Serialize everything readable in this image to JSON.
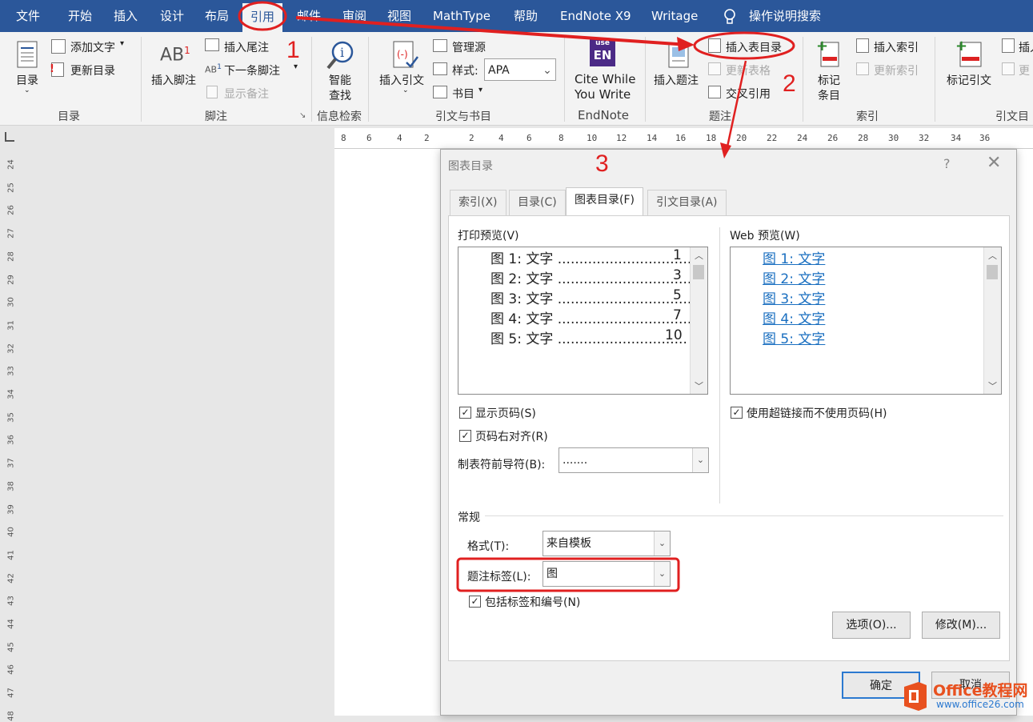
{
  "tabs": [
    "文件",
    "开始",
    "插入",
    "设计",
    "布局",
    "引用",
    "邮件",
    "审阅",
    "视图",
    "MathType",
    "帮助",
    "EndNote X9",
    "Writage"
  ],
  "tell_me": "操作说明搜索",
  "ribbon": {
    "toc": {
      "label": "目录",
      "add_text": "添加文字",
      "update": "更新目录",
      "group": "目录"
    },
    "footnotes": {
      "insert": "插入脚注",
      "insert_endnote": "插入尾注",
      "next": "下一条脚注",
      "show": "显示备注",
      "group": "脚注"
    },
    "research": {
      "smart_lookup": "智能",
      "smart_lookup2": "查找",
      "group": "信息检索"
    },
    "citations": {
      "insert": "插入引文",
      "manage": "管理源",
      "style_label": "样式:",
      "style_value": "APA",
      "bibliography": "书目",
      "group": "引文与书目"
    },
    "endnote": {
      "cwyw1": "Cite While",
      "cwyw2": "You Write",
      "group": "EndNote",
      "logo": "EN",
      "logo_top": "use"
    },
    "captions": {
      "insert_caption": "插入题注",
      "insert_tof": "插入表目录",
      "update_table": "更新表格",
      "cross_ref": "交叉引用",
      "group": "题注"
    },
    "index": {
      "mark1": "标记",
      "mark2": "条目",
      "insert": "插入索引",
      "update": "更新索引",
      "group": "索引"
    },
    "toa": {
      "mark": "标记引文",
      "insert": "插入",
      "group": "引文目",
      "update": "更"
    }
  },
  "ruler_h": [
    "8",
    "6",
    "4",
    "2",
    "2",
    "4",
    "6",
    "8",
    "10",
    "12",
    "14",
    "16",
    "18",
    "20",
    "22",
    "24",
    "26",
    "28",
    "30",
    "32",
    "34",
    "36"
  ],
  "ruler_v": [
    "24",
    "25",
    "26",
    "27",
    "28",
    "29",
    "30",
    "31",
    "32",
    "33",
    "34",
    "35",
    "36",
    "37",
    "38",
    "39",
    "40",
    "41",
    "42",
    "43",
    "44",
    "45",
    "46",
    "47",
    "48"
  ],
  "dialog": {
    "title": "图表目录",
    "help": "?",
    "tabs": [
      "索引(X)",
      "目录(C)",
      "图表目录(F)",
      "引文目录(A)"
    ],
    "print_preview_label": "打印预览(V)",
    "print_rows": [
      {
        "text": "图 1: 文字 ..................................",
        "page": "1"
      },
      {
        "text": "图 2: 文字 ..................................",
        "page": "3"
      },
      {
        "text": "图 3: 文字 ..................................",
        "page": "5"
      },
      {
        "text": "图 4: 文字 ..................................",
        "page": "7"
      },
      {
        "text": "图 5: 文字 ..............................",
        "page": "10"
      }
    ],
    "web_preview_label": "Web 预览(W)",
    "web_rows": [
      "图 1: 文字",
      "图 2: 文字",
      "图 3: 文字",
      "图 4: 文字",
      "图 5: 文字"
    ],
    "show_page_numbers": "显示页码(S)",
    "right_align": "页码右对齐(R)",
    "tab_leader_label": "制表符前导符(B):",
    "tab_leader_value": ".......",
    "use_hyperlinks": "使用超链接而不使用页码(H)",
    "general": "常规",
    "format_label": "格式(T):",
    "format_value": "来自模板",
    "caption_label": "题注标签(L):",
    "caption_value": "图",
    "include_label": "包括标签和编号(N)",
    "options_btn": "选项(O)...",
    "modify_btn": "修改(M)...",
    "ok_btn": "确定",
    "cancel_btn": "取消"
  },
  "annotations": {
    "n1": "1",
    "n2": "2",
    "n3": "3"
  },
  "watermark": {
    "brand": "Office教程网",
    "url": "www.office26.com"
  },
  "colors": {
    "accent": "#2b579a",
    "annotation": "#e02020",
    "link": "#1a6fc0"
  }
}
